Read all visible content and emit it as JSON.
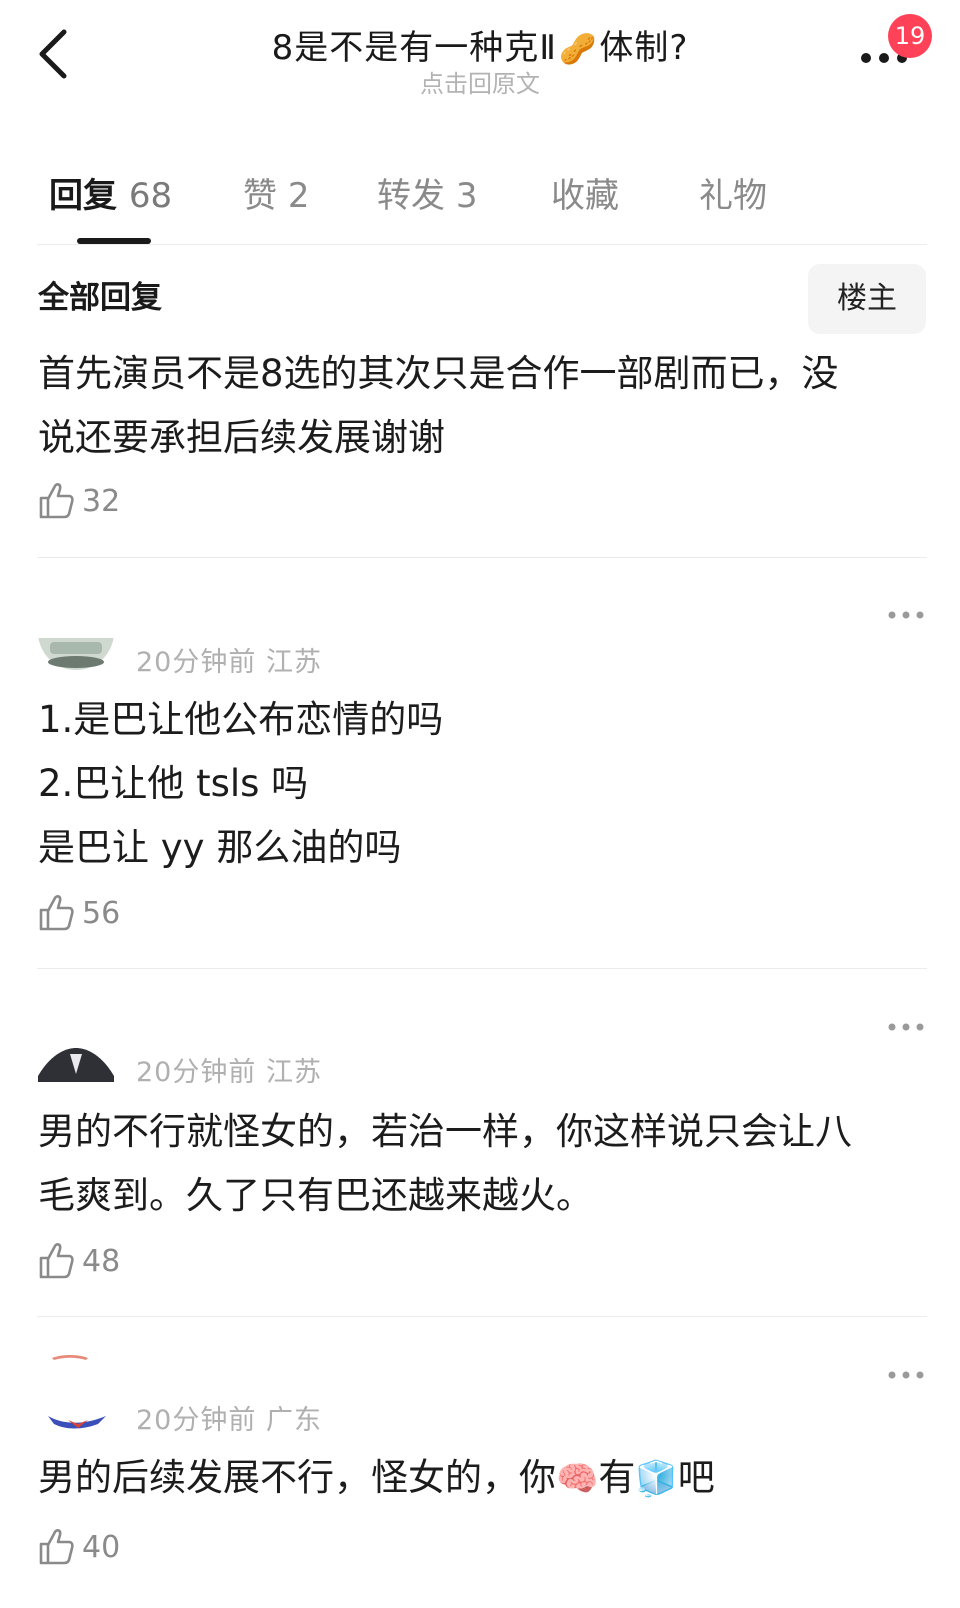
{
  "header": {
    "title_part1": "8是不是有一种克Ⅱ",
    "title_emoji": "🥜",
    "title_part2": "体制?",
    "subtitle": "点击回原文",
    "notification_count": "19"
  },
  "tabs": [
    {
      "label": "回复",
      "count": "68"
    },
    {
      "label": "赞",
      "count": "2"
    },
    {
      "label": "转发",
      "count": "3"
    },
    {
      "label": "收藏",
      "count": ""
    },
    {
      "label": "礼物",
      "count": ""
    }
  ],
  "section": {
    "title": "全部回复",
    "owner_button": "楼主"
  },
  "comments": [
    {
      "lines": [
        "首先演员不是8选的其次只是合作一部剧而已，没",
        "说还要承担后续发展谢谢"
      ],
      "likes": "32"
    },
    {
      "time": "20分钟前",
      "location": "江苏",
      "lines": [
        "1.是巴让他公布恋情的吗",
        "2.巴让他 tsls 吗",
        "是巴让 yy 那么油的吗"
      ],
      "likes": "56"
    },
    {
      "time": "20分钟前",
      "location": "江苏",
      "lines": [
        "男的不行就怪女的，若治一样，你这样说只会让八",
        "毛爽到。久了只有巴还越来越火。"
      ],
      "likes": "48"
    },
    {
      "time": "20分钟前",
      "location": "广东",
      "text_a": "男的后续发展不行，怪女的，你",
      "emoji_a": "🧠",
      "text_b": "有",
      "emoji_b": "🧊",
      "text_c": "吧",
      "likes": "40"
    }
  ]
}
